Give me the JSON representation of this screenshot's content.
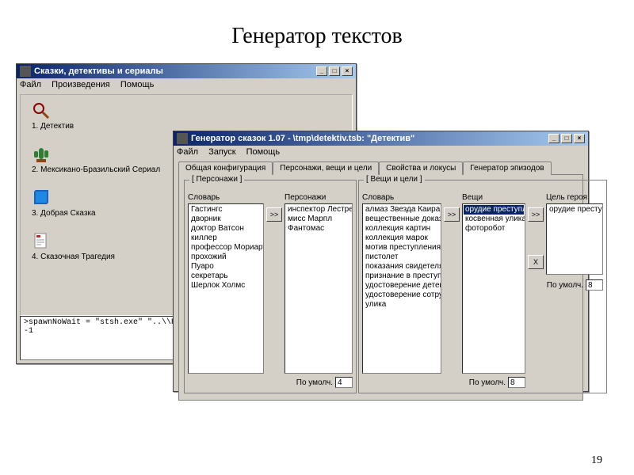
{
  "slide": {
    "title": "Генератор текстов",
    "page_number": "19"
  },
  "back_window": {
    "title": "Сказки, детективы и сериалы",
    "menu": [
      "Файл",
      "Произведения",
      "Помощь"
    ],
    "items": [
      {
        "label": "1. Детектив"
      },
      {
        "label": "2. Мексикано-Бразильский Сериал"
      },
      {
        "label": "3. Добрая Сказка"
      },
      {
        "label": "4. Сказочная Трагедия"
      }
    ],
    "console_line1": ">spawnNoWait = \"stsh.exe\" \"..\\\\Проекты\\\\Детектив.sp",
    "console_line2": "-1"
  },
  "front_window": {
    "title": "Генератор сказок 1.07 - \\tmp\\detektiv.tsb:   \"Детектив\"",
    "menu": [
      "Файл",
      "Запуск",
      "Помощь"
    ],
    "tabs": [
      "Общая конфигурация",
      "Персонажи, вещи и цели",
      "Свойства и локусы",
      "Генератор эпизодов"
    ],
    "active_tab": 1,
    "group_chars": {
      "caption": "[ Персонажи ]",
      "dict_label": "Словарь",
      "dict_items": [
        "Гастингс",
        "дворник",
        "доктор Ватсон",
        "киллер",
        "профессор Мориарти",
        "прохожий",
        "Пуаро",
        "секретарь",
        "Шерлок Холмс"
      ],
      "chars_label": "Персонажи",
      "chars_items": [
        "инспектор Лестрейд",
        "мисс Марпл",
        "Фантомас"
      ],
      "default_label": "По умолч.",
      "default_value": "4"
    },
    "group_things": {
      "caption": "[ Вещи и цели ]",
      "dict_label": "Словарь",
      "dict_items": [
        "алмаз Звезда Каира",
        "вещественные доказа",
        "коллекция картин",
        "коллекция марок",
        "мотив преступления",
        "пистолет",
        "показания свидетеля",
        "признание в преступле",
        "удостоверение детекти",
        "удостоверение сотрудн",
        "улика"
      ],
      "things_label": "Вещи",
      "things_items": [
        "орудие преступления",
        "косвенная улика",
        "фоторобот"
      ],
      "things_default_label": "По умолч.",
      "things_default_value": "8",
      "goal_label": "Цель героя",
      "goal_items": [
        "орудие преступления"
      ],
      "goal_default_label": "По умолч.",
      "goal_default_value": "8"
    },
    "buttons": {
      "add": ">>",
      "remove": "X"
    }
  }
}
